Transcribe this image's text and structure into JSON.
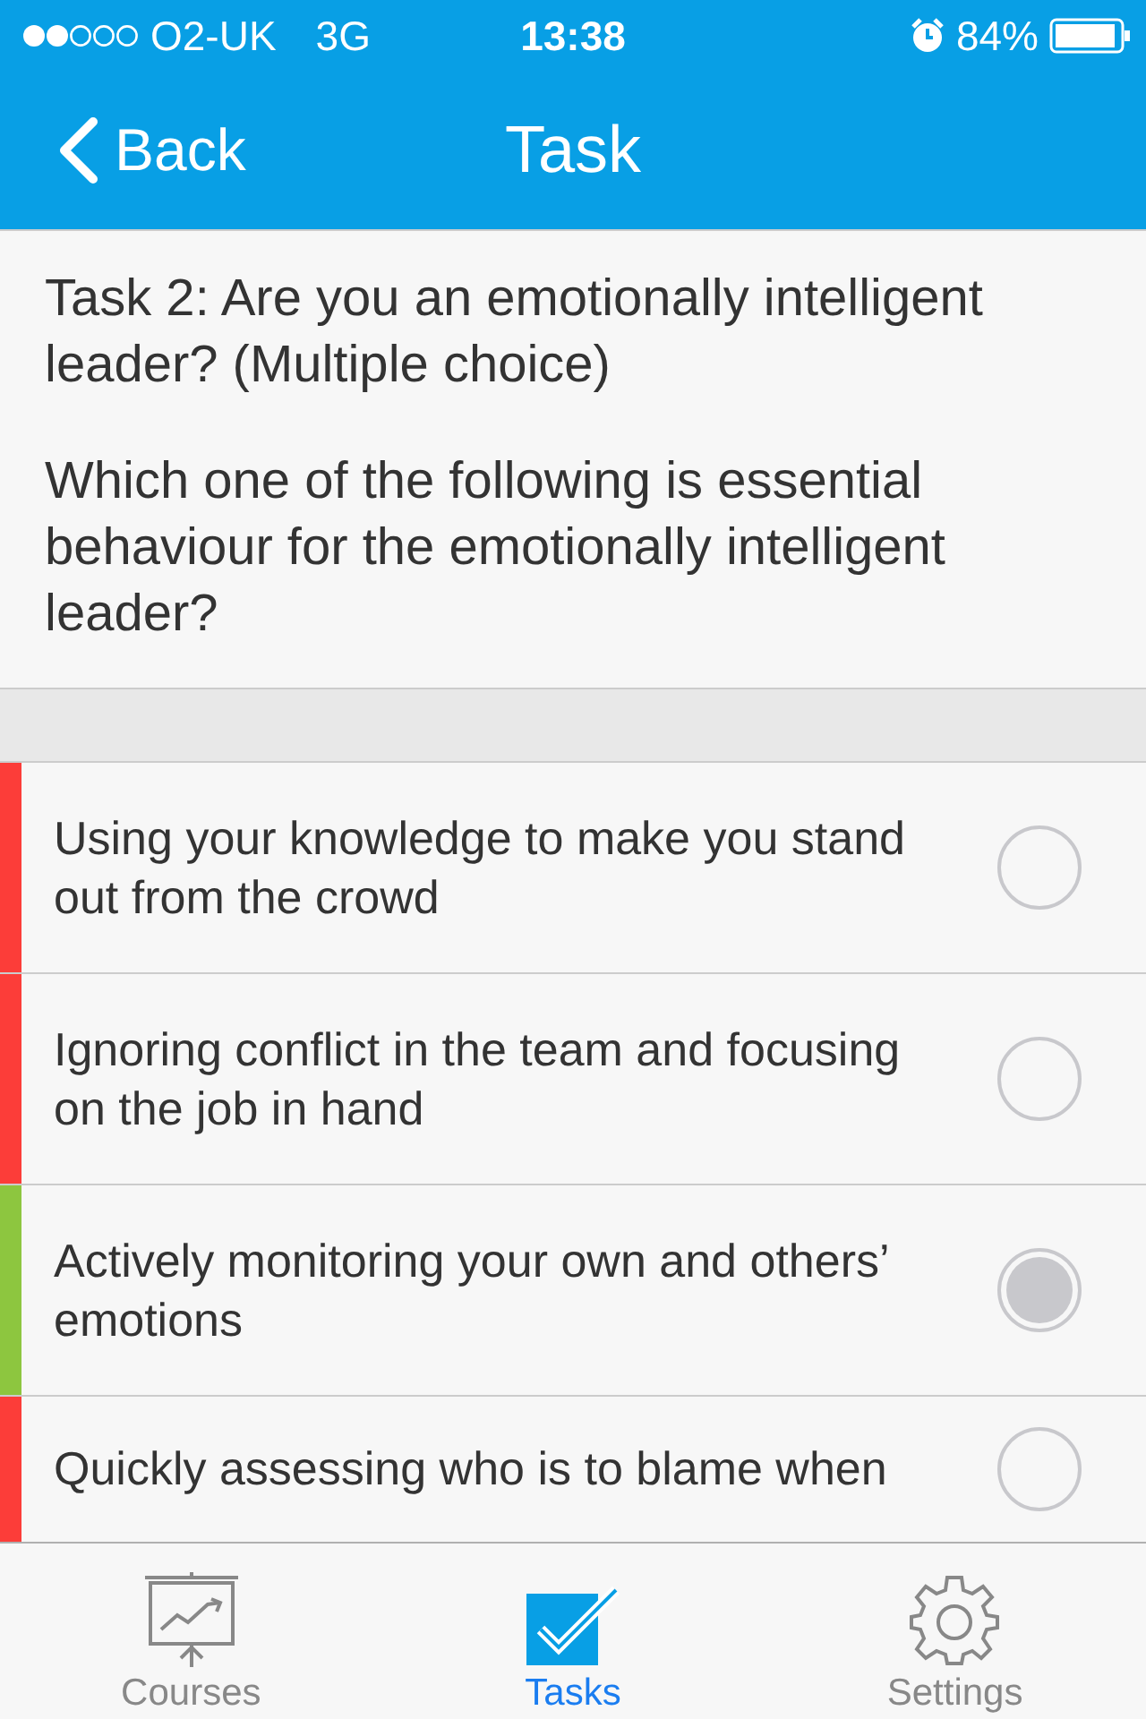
{
  "status_bar": {
    "carrier": "O2-UK",
    "network": "3G",
    "time": "13:38",
    "battery": "84%"
  },
  "nav": {
    "back": "Back",
    "title": "Task"
  },
  "task": {
    "title": "Task 2: Are you an emotionally intelligent leader? (Multiple choice)",
    "question": "Which one of the following is essential behaviour for the emotionally intelligent leader?"
  },
  "options": [
    {
      "text": "Using your knowledge to make you stand out from the crowd",
      "color": "#fc3d39",
      "selected": false
    },
    {
      "text": "Ignoring conflict in the team and focusing on the job in hand",
      "color": "#fc3d39",
      "selected": false
    },
    {
      "text": "Actively monitoring your own and others’ emotions",
      "color": "#8dc63f",
      "selected": true
    },
    {
      "text": "Quickly assessing who is to blame when",
      "color": "#fc3d39",
      "selected": false
    }
  ],
  "tab_bar": [
    {
      "kind": "courses",
      "label": "Courses",
      "selected": false
    },
    {
      "kind": "tasks",
      "label": "Tasks",
      "selected": true
    },
    {
      "kind": "settings",
      "label": "Settings",
      "selected": false
    }
  ]
}
